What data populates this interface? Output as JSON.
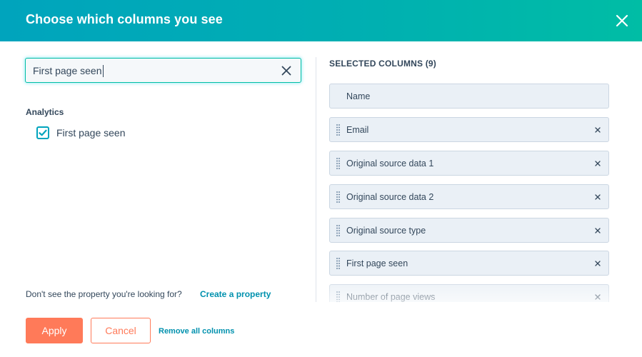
{
  "dialog": {
    "title": "Choose which columns you see",
    "close_icon": "close-icon"
  },
  "search": {
    "value": "First page seen",
    "clear_icon": "clear-icon"
  },
  "results": {
    "group_label": "Analytics",
    "items": [
      {
        "label": "First page seen",
        "checked": true
      }
    ]
  },
  "footer": {
    "hint": "Don't see the property you're looking for?",
    "create_link": "Create a property",
    "apply_label": "Apply",
    "cancel_label": "Cancel",
    "remove_all_label": "Remove all columns"
  },
  "selected": {
    "heading": "SELECTED COLUMNS (9)",
    "columns": [
      {
        "label": "Name",
        "fixed": true
      },
      {
        "label": "Email",
        "fixed": false
      },
      {
        "label": "Original source data 1",
        "fixed": false
      },
      {
        "label": "Original source data 2",
        "fixed": false
      },
      {
        "label": "Original source type",
        "fixed": false
      },
      {
        "label": "First page seen",
        "fixed": false
      },
      {
        "label": "Number of page views",
        "fixed": false
      }
    ]
  },
  "colors": {
    "header_start": "#00a4bd",
    "header_end": "#00bda5",
    "primary_button": "#ff7a59",
    "link": "#0091ae",
    "column_bg": "#eaf0f6"
  }
}
